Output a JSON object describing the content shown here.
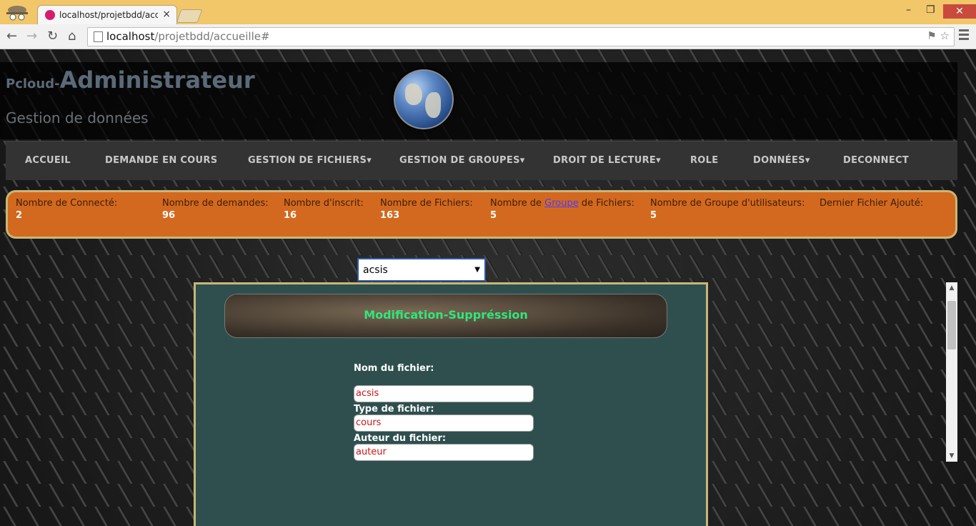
{
  "browser": {
    "tab_title": "localhost/projetbdd/accu",
    "tab_close": "×",
    "url_host": "localhost",
    "url_path": "/projetbdd/accueille#",
    "win_minimize": "–",
    "win_restore": "❐",
    "win_close": "✕",
    "back": "←",
    "forward": "→",
    "reload": "↻",
    "home": "⌂",
    "omni_icons": "⚑ ☆"
  },
  "header": {
    "brand_small": "Pcloud-",
    "brand_big": "Administrateur",
    "subtitle": "Gestion de données"
  },
  "nav": {
    "items": [
      "ACCUEIL",
      "DEMANDE EN COURS",
      "GESTION DE FICHIERS▾",
      "GESTION DE GROUPES▾",
      "DROIT DE LECTURE▾",
      "ROLE",
      "DONNÉES▾",
      "DECONNECT"
    ]
  },
  "stats": [
    {
      "label": "Nombre de Connecté:",
      "value": "2"
    },
    {
      "label": "Nombre de demandes:",
      "value": "96"
    },
    {
      "label": "Nombre d'inscrit:",
      "value": "16"
    },
    {
      "label": "Nombre de Fichiers:",
      "value": "163"
    },
    {
      "label_pre": "Nombre de ",
      "label_link": "Groupe",
      "label_post": " de Fichiers:",
      "value": "5"
    },
    {
      "label": "Nombre de Groupe d'utilisateurs:",
      "value": "5"
    },
    {
      "label": "Dernier Fichier Ajouté:",
      "value": ""
    }
  ],
  "file_select": {
    "value": "acsis",
    "arrow": "▼"
  },
  "panel": {
    "title": "Modification-Suppréssion",
    "fields": [
      {
        "label": "Nom du fichier:",
        "value": "acsis"
      },
      {
        "label": "Type de fichier:",
        "value": "cours"
      },
      {
        "label": "Auteur du fichier:",
        "value": "auteur"
      }
    ]
  },
  "scrollbar": {
    "up": "▲",
    "down": "▼"
  }
}
